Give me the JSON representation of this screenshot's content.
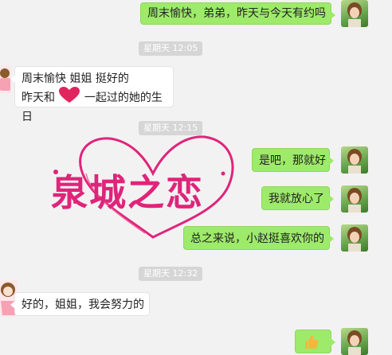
{
  "messages": {
    "m1": "周末愉快，弟弟，昨天与今天有约吗",
    "m2_line1": "周末愉快  姐姐  挺好的",
    "m2_line2a": "昨天和",
    "m2_line2b": "一起过的她的生日",
    "m3": "是吧，那就好",
    "m4": "我就放心了",
    "m5": "总之来说，小赵挺喜欢你的",
    "m6": "好的，姐姐，我会努力的"
  },
  "timestamps": {
    "t1": "星期天 12:05",
    "t2": "星期天 12:15",
    "t3": "星期天 12:32"
  },
  "logo": {
    "text": "泉城之恋"
  },
  "colors": {
    "bubble_self": "#9eea6a",
    "bubble_other": "#ffffff",
    "background": "#f2f2f2",
    "logo_pink": "#e0247a"
  },
  "icons": [
    "heart-emoji-icon",
    "thumbs-up-icon"
  ]
}
